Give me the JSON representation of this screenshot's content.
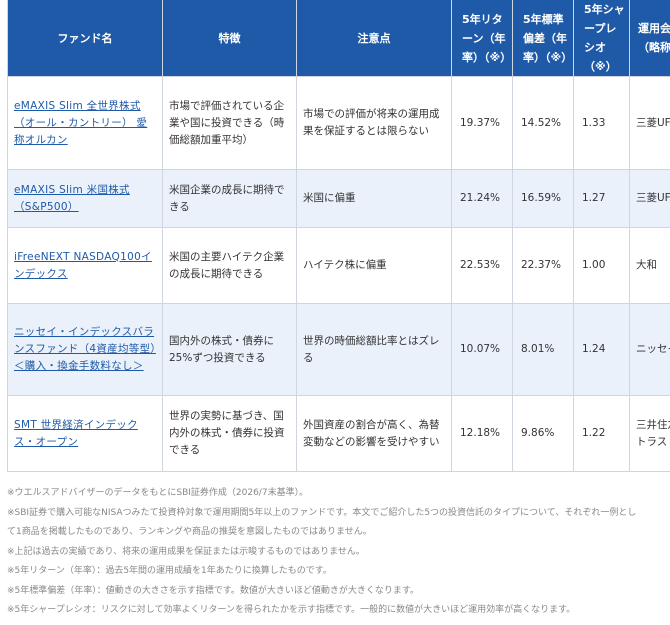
{
  "table": {
    "headers": {
      "fund_name": "ファンド名",
      "feature": "特徴",
      "caution": "注意点",
      "return_5y": "5年リターン（年率）（※）",
      "stdev_5y": "5年標準偏差（年率）（※）",
      "sharpe_5y": "5年シャープレシオ（※）",
      "company": "運用会社（略称）"
    },
    "rows": [
      {
        "name": "eMAXIS Slim 全世界株式（オール・カントリー） 愛称オルカン",
        "feature": "市場で評価されている企業や国に投資できる（時価総額加重平均）",
        "caution": "市場での評価が将来の運用成果を保証するとは限らない",
        "return_5y": "19.37%",
        "stdev_5y": "14.52%",
        "sharpe_5y": "1.33",
        "company": "三菱UFJ"
      },
      {
        "name": "eMAXIS Slim 米国株式（S&P500）",
        "feature": "米国企業の成長に期待できる",
        "caution": "米国に偏重",
        "return_5y": "21.24%",
        "stdev_5y": "16.59%",
        "sharpe_5y": "1.27",
        "company": "三菱UFJ"
      },
      {
        "name": "iFreeNEXT NASDAQ100インデックス",
        "feature": "米国の主要ハイテク企業の成長に期待できる",
        "caution": "ハイテク株に偏重",
        "return_5y": "22.53%",
        "stdev_5y": "22.37%",
        "sharpe_5y": "1.00",
        "company": "大和"
      },
      {
        "name": "ニッセイ・インデックスバランスファンド（4資産均等型）＜購入・換金手数料なし＞",
        "feature": "国内外の株式・債券に25%ずつ投資できる",
        "caution": "世界の時価総額比率とはズレる",
        "return_5y": "10.07%",
        "stdev_5y": "8.01%",
        "sharpe_5y": "1.24",
        "company": "ニッセイ"
      },
      {
        "name": "SMT 世界経済インデックス・オープン",
        "feature": "世界の実勢に基づき、国内外の株式・債券に投資できる",
        "caution": "外国資産の割合が高く、為替変動などの影響を受けやすい",
        "return_5y": "12.18%",
        "stdev_5y": "9.86%",
        "sharpe_5y": "1.22",
        "company": "三井住友トラスト"
      }
    ]
  },
  "notes": [
    "※ウエルスアドバイザーのデータをもとにSBI証券作成（2026/7末基準）。",
    "※SBI証券で購入可能なNISAつみたて投資枠対象で運用期間5年以上のファンドです。本文でご紹介した5つの投資信託のタイプについて、それぞれ一例とし",
    "て1商品を掲載したものであり、ランキングや商品の推奨を意図したものではありません。",
    "※上記は過去の実績であり、将来の運用成果を保証または示唆するものではありません。",
    "※5年リターン（年率）：過去5年間の運用成績を1年あたりに換算したものです。",
    "※5年標準偏差（年率）：値動きの大きさを示す指標です。数値が大きいほど値動きが大きくなります。",
    "※5年シャープレシオ：リスクに対して効率よくリターンを得られたかを示す指標です。一般的に数値が大きいほど運用効率が高くなります。"
  ]
}
